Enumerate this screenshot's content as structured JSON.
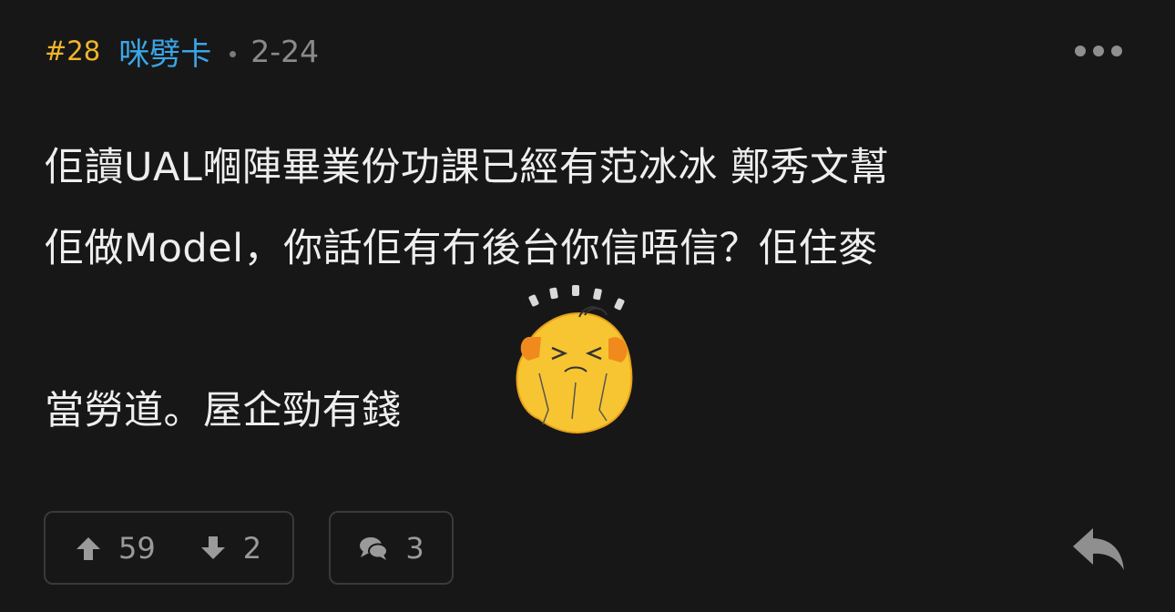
{
  "post": {
    "floor": "#28",
    "username": "咪劈卡",
    "time": "2-24",
    "content_lines": [
      "佢讀UAL嗰陣畢業份功課已經有范冰冰 鄭秀文幫",
      "佢做Model，你話佢有冇後台你信唔信？佢住麥",
      "",
      "當勞道。屋企勁有錢"
    ],
    "sticker": "head-scratching-emoji-sticker"
  },
  "actions": {
    "upvotes": "59",
    "downvotes": "2",
    "comments": "3"
  },
  "icons": {
    "more": "more-horizontal-icon",
    "upvote": "arrow-up-icon",
    "downvote": "arrow-down-icon",
    "comment": "comment-bubbles-icon",
    "reply": "reply-arrow-icon"
  },
  "colors": {
    "background": "#171717",
    "floor": "#f1b52a",
    "username": "#3ba6e8",
    "muted": "#8a8a8a"
  }
}
